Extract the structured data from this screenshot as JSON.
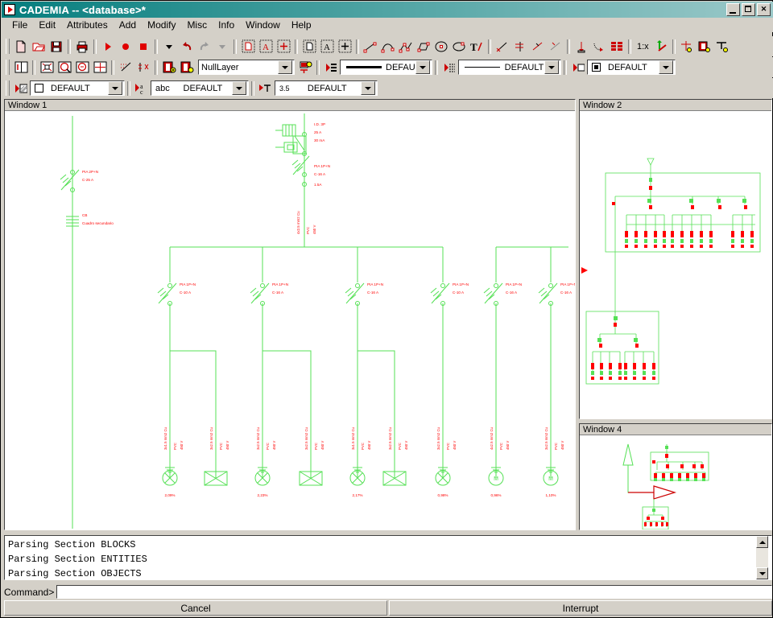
{
  "window": {
    "title": "CADEMIA -- <database>*",
    "icon": "play-triangle-icon",
    "buttons": {
      "minimize": "_",
      "maximize": "□",
      "close": "✕"
    }
  },
  "menubar": {
    "items": [
      "File",
      "Edit",
      "Attributes",
      "Add",
      "Modify",
      "Misc",
      "Info",
      "Window",
      "Help"
    ]
  },
  "toolbars": {
    "row1": {
      "icons": [
        "new-file-icon",
        "open-folder-icon",
        "save-disk-icon",
        "print-icon",
        "play-icon",
        "record-icon",
        "stop-icon",
        "dropdown-arrow-icon",
        "undo-icon",
        "redo-icon",
        "redo-dropdown-icon",
        "select-object-icon",
        "select-text-icon",
        "select-point-icon",
        "deselect-object-icon",
        "deselect-text-icon",
        "deselect-point-icon",
        "draw-line-icon",
        "draw-arc-icon",
        "draw-polyline-icon",
        "draw-rectangle-icon",
        "draw-circle-icon",
        "draw-ellipse-icon",
        "draw-text-icon",
        "modify-trim-icon",
        "modify-extend-icon",
        "modify-break-icon",
        "modify-fillet-icon",
        "dimension-icon",
        "dimension-angle-icon",
        "table-icon",
        "scale-label",
        "scale-pick-icon",
        "attribute-point-icon",
        "attribute-block-icon",
        "attribute-text-icon"
      ],
      "scale_label": "1:x"
    },
    "row2": {
      "icons": [
        "view-split-icon",
        "zoom-all-icon",
        "zoom-window-icon",
        "zoom-out-icon",
        "zoom-extents-icon",
        "grid-snap-icon",
        "object-snap-icon",
        "layer-new-icon",
        "layer-delete-icon",
        "layer-manager-icon",
        "lineweight-picker-icon",
        "linetype-picker-icon",
        "color-picker-icon"
      ],
      "layer_combo": {
        "label": "layer-combo",
        "value": "NullLayer"
      },
      "lineweight_combo": {
        "value": "DEFAULT",
        "icon": "thick-line-icon"
      },
      "linetype_combo": {
        "value": "DEFAULT",
        "icon": "thin-line-icon"
      },
      "color_combo": {
        "value": "DEFAULT",
        "icon": "black-swatch-icon"
      }
    },
    "row3": {
      "hatch_combo": {
        "value": "DEFAULT",
        "icon": "hatch-swatch-icon"
      },
      "textstyle_combo": {
        "value": "DEFAULT",
        "prefix": "abc",
        "icon": "text-style-icon"
      },
      "textheight_combo": {
        "value": "DEFAULT",
        "prefix": "3.5",
        "icon": "text-height-icon"
      }
    }
  },
  "cad_windows": [
    {
      "id": "win1",
      "title": "Window 1"
    },
    {
      "id": "win2",
      "title": "Window 2"
    },
    {
      "id": "win4",
      "title": "Window 4"
    }
  ],
  "schematic": {
    "main_feed_label": [
      "PIA 2P+N",
      "C-25 A"
    ],
    "earth_label": [
      "CB",
      "Cuadro secundario"
    ],
    "rcd_labels": [
      "I.D. 3P",
      "25 A",
      "30 mA"
    ],
    "rcd_branch_labels": [
      "PIA 1P+N",
      "C-16 A",
      "1.5A"
    ],
    "branches": [
      {
        "breaker": "PIA 1P+N",
        "rating": "C-10 A",
        "cable": "3x1.5 mm2 Cu",
        "cable2": "PVC",
        "cable3": "450/750 V",
        "load": "lamp",
        "drop": "2,09%"
      },
      {
        "breaker": "PIA 1P+N",
        "rating": "C-16 A",
        "cable": "3x2.5 mm2 Cu",
        "cable2": "PVC",
        "cable3": "450/750 V",
        "load": "socket",
        "drop": ""
      },
      {
        "breaker": "PIA 1P+N",
        "rating": "C-16 A",
        "cable": "3x2.5 mm2 Cu",
        "cable2": "PVC",
        "cable3": "450/750 V",
        "load": "lamp",
        "drop": "2,23%"
      },
      {
        "breaker": "PIA 1P+N",
        "rating": "C-10 A",
        "cable": "3x1.5 mm2 Cu",
        "cable2": "PVC",
        "cable3": "450/750 V",
        "load": "socket",
        "drop": ""
      },
      {
        "breaker": "PIA 1P+N",
        "rating": "C-16 A",
        "cable": "3x2.5 mm2 Cu",
        "cable2": "PVC",
        "cable3": "450/750 V",
        "load": "lamp",
        "drop": "2,17%"
      },
      {
        "breaker": "PIA 1P+N",
        "rating": "C-16 A",
        "cable": "3x2.5 mm2 Cu",
        "cable2": "PVC",
        "cable3": "450/750 V",
        "load": "socket",
        "drop": ""
      },
      {
        "breaker": "PIA 1P+N",
        "rating": "C-10 A",
        "cable": "3x1.5 mm2 Cu",
        "cable2": "PVC",
        "cable3": "450/750 V",
        "load": "lamp",
        "drop": "0,98%"
      },
      {
        "breaker": "PIA 1P+N",
        "rating": "C-16 A",
        "cable": "4x2.5 mm2 Cu",
        "cable2": "PVC",
        "cable3": "450/750 V",
        "load": "motor",
        "drop": "0,96%"
      },
      {
        "breaker": "PIA 1P+N",
        "rating": "C-16 A",
        "cable": "3x2.5 mm2 Cu",
        "cable2": "PVC",
        "cable3": "450/750 V",
        "load": "motor",
        "drop": "1,10%"
      }
    ]
  },
  "console": {
    "lines": [
      "Parsing Section BLOCKS",
      "Parsing Section ENTITIES",
      "Parsing Section OBJECTS"
    ],
    "prompt": "Command>",
    "input_value": ""
  },
  "footer": {
    "cancel_label": "Cancel",
    "interrupt_label": "Interrupt"
  },
  "colors": {
    "titlebar": "#067e7e",
    "face": "#d4d0c8",
    "cad_green": "#55e055",
    "cad_red": "#ff0000",
    "accent_red": "#cc0000"
  }
}
